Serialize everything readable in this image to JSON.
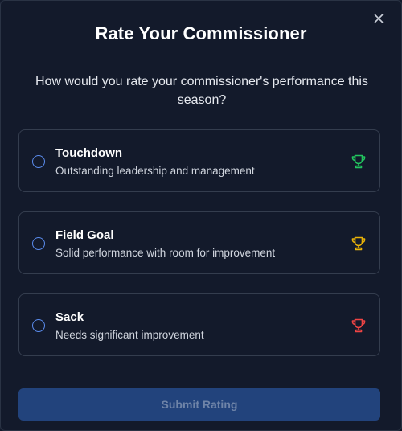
{
  "dialog": {
    "title": "Rate Your Commissioner",
    "question": "How would you rate your commissioner's performance this season?",
    "close_icon": "close-icon"
  },
  "options": [
    {
      "label": "Touchdown",
      "description": "Outstanding leadership and management",
      "icon": "trophy-icon",
      "icon_color": "#22c55e",
      "selected": false
    },
    {
      "label": "Field Goal",
      "description": "Solid performance with room for improvement",
      "icon": "trophy-icon",
      "icon_color": "#eab308",
      "selected": false
    },
    {
      "label": "Sack",
      "description": "Needs significant improvement",
      "icon": "trophy-icon",
      "icon_color": "#ef4444",
      "selected": false
    }
  ],
  "submit": {
    "label": "Submit Rating",
    "disabled": true
  },
  "colors": {
    "background": "#131a2b",
    "radio_border": "#5b8def",
    "submit_bg": "#22437c",
    "submit_text": "#6f84a8"
  }
}
